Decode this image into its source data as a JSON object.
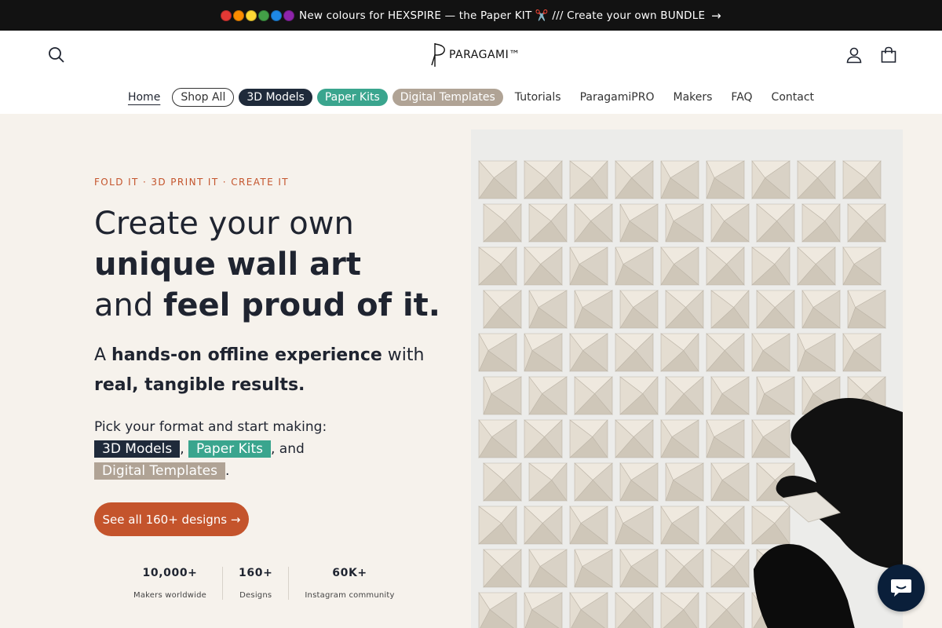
{
  "colors": {
    "accent_orange": "#c4542c",
    "navy": "#1f2a3a",
    "teal": "#3aa58e",
    "taupe": "#b0a395",
    "hero_bg": "#f6f2ec",
    "dark_bar": "#121212"
  },
  "announcement": {
    "dot_colors": [
      "#e53935",
      "#fb8c00",
      "#fdd835",
      "#43a047",
      "#1e88e5",
      "#8e24aa"
    ],
    "text": "New colours for HEXSPIRE — the Paper KIT ✂️ /// Create your own BUNDLE",
    "arrow": "→"
  },
  "header": {
    "logo_text": "PARAGAMI™",
    "search_icon": "search-icon",
    "account_icon": "account-icon",
    "cart_icon": "cart-icon"
  },
  "nav": {
    "home": "Home",
    "shop_all": "Shop All",
    "models": "3D Models",
    "paper_kits": "Paper Kits",
    "templates": "Digital Templates",
    "tutorials": "Tutorials",
    "pro": "ParagamiPRO",
    "makers": "Makers",
    "faq": "FAQ",
    "contact": "Contact"
  },
  "hero": {
    "eyebrow": "FOLD IT · 3D PRINT IT · CREATE IT",
    "headline_line1": "Create your own",
    "headline_line2_bold": "unique wall art",
    "headline_line3_pre": "and ",
    "headline_line3_bold": "feel proud of it.",
    "sub_pre": "A ",
    "sub_bold1": "hands-on offline experience",
    "sub_mid": " with",
    "sub_bold2": "real, tangible results.",
    "pick_text": "Pick your format and start making:",
    "tag_models": "3D Models",
    "sep1": ",",
    "tag_kits": "Paper Kits",
    "sep2": ", and",
    "tag_templates": "Digital Templates",
    "sep3": ".",
    "cta": "See all 160+ designs →"
  },
  "stats": [
    {
      "value": "10,000+",
      "label": "Makers worldwide"
    },
    {
      "value": "160+",
      "label": "Designs"
    },
    {
      "value": "60K+",
      "label": "Instagram community"
    }
  ],
  "chat": {
    "icon": "chat-icon"
  }
}
